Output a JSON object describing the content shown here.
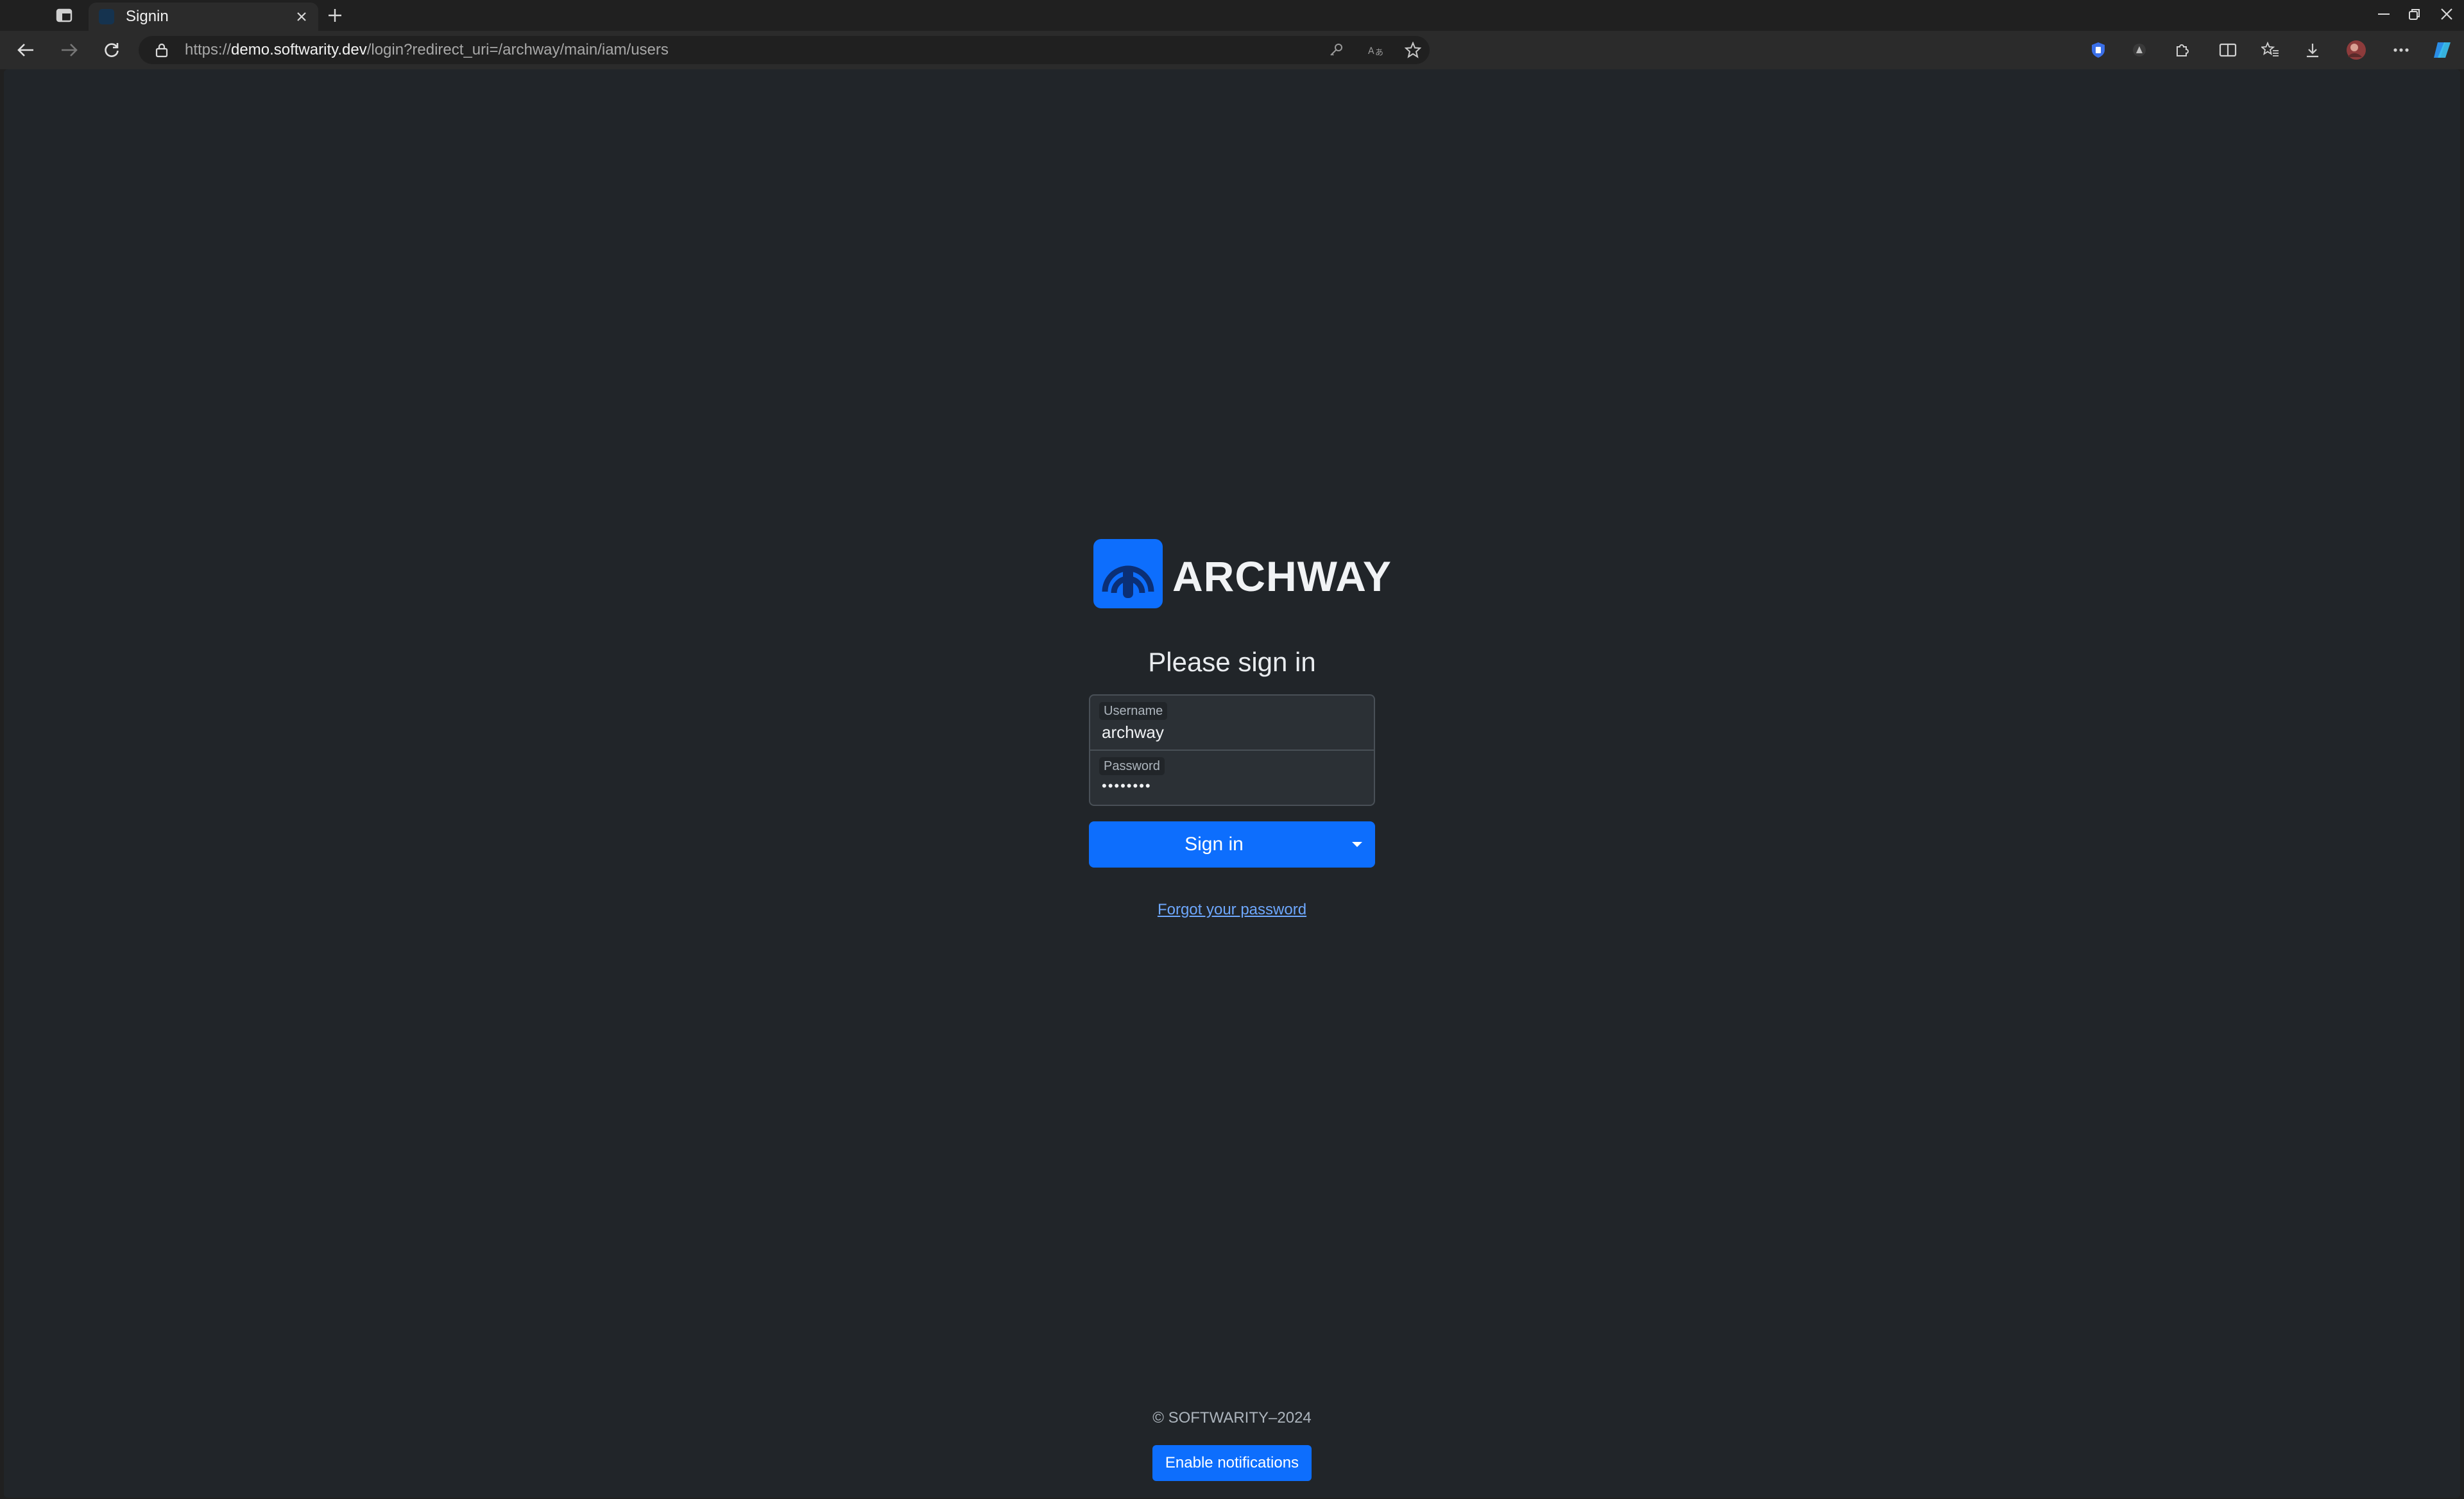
{
  "browser": {
    "tab": {
      "title": "Signin"
    },
    "address": {
      "scheme": "https://",
      "host": "demo.softwarity.dev",
      "path": "/login?redirect_uri=/archway/main/iam/users"
    },
    "icons": {
      "tab_actions": "tab-actions-icon",
      "new_tab": "plus-icon",
      "back": "arrow-left-icon",
      "forward": "arrow-right-icon",
      "reload": "reload-icon",
      "lock": "lock-icon",
      "key": "key-icon",
      "translate": "translate-icon",
      "favorite": "star-icon"
    }
  },
  "page": {
    "brand": "ARCHWAY",
    "heading": "Please sign in",
    "username": {
      "label": "Username",
      "value": "archway"
    },
    "password": {
      "label": "Password",
      "value": "••••••••"
    },
    "signin_button": "Sign in",
    "forgot_link": "Forgot your password",
    "copyright": "© SOFTWARITY–2024",
    "notify_button": "Enable notifications"
  },
  "colors": {
    "accent": "#0d6efd",
    "page_bg": "#212529",
    "link": "#6ea8fe",
    "chrome_bg": "#202020",
    "toolbar_bg": "#2b2b2b"
  }
}
